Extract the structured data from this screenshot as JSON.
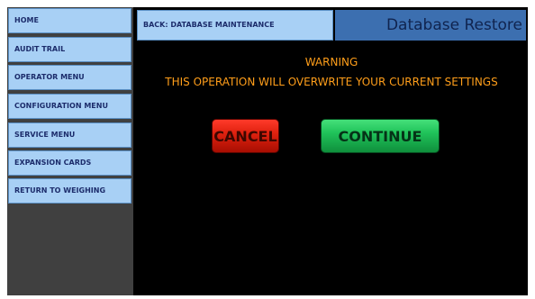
{
  "sidebar": {
    "items": [
      {
        "label": "HOME"
      },
      {
        "label": "AUDIT TRAIL"
      },
      {
        "label": "OPERATOR MENU"
      },
      {
        "label": "CONFIGURATION MENU"
      },
      {
        "label": "SERVICE MENU"
      },
      {
        "label": "EXPANSION CARDS"
      },
      {
        "label": "RETURN TO WEIGHING"
      }
    ]
  },
  "header": {
    "back_label": "BACK: DATABASE MAINTENANCE",
    "title": "Database Restore"
  },
  "dialog": {
    "warning_title": "WARNING",
    "warning_message": "THIS OPERATION WILL OVERWRITE YOUR CURRENT SETTINGS",
    "cancel_label": "CANCEL",
    "continue_label": "CONTINUE"
  },
  "colors": {
    "nav_button": "#a8d0f5",
    "title_bar": "#3c6fb0",
    "warning_text": "#ff9e1a",
    "cancel_button": "#e02210",
    "continue_button": "#20c35a",
    "background": "#000000"
  }
}
